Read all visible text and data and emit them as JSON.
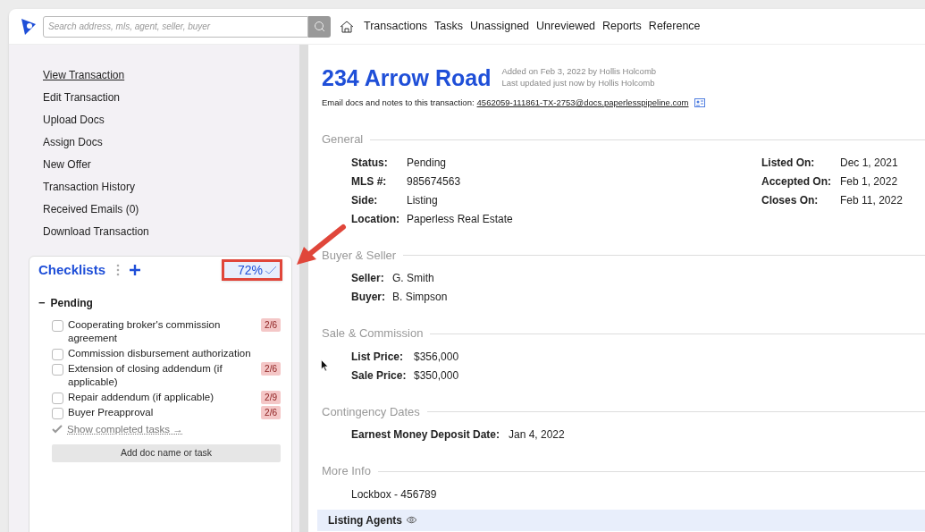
{
  "header": {
    "search": {
      "placeholder": "Search address, mls, agent, seller, buyer"
    },
    "nav": [
      {
        "label": "Transactions",
        "selected": false
      },
      {
        "label": "Tasks",
        "selected": false
      },
      {
        "label": "Unassigned",
        "selected": false
      },
      {
        "label": "Unreviewed",
        "selected": false
      },
      {
        "label": "Reports",
        "selected": false
      },
      {
        "label": "Reference",
        "selected": false
      }
    ]
  },
  "sidebar": {
    "items": [
      {
        "label": "View Transaction",
        "selected": true
      },
      {
        "label": "Edit Transaction",
        "selected": false
      },
      {
        "label": "Upload Docs",
        "selected": false
      },
      {
        "label": "Assign Docs",
        "selected": false
      },
      {
        "label": "New Offer",
        "selected": false
      },
      {
        "label": "Transaction History",
        "selected": false
      },
      {
        "label": "Received Emails (0)",
        "selected": false
      },
      {
        "label": "Download Transaction",
        "selected": false
      }
    ]
  },
  "checklists": {
    "title": "Checklists",
    "percent": "72%",
    "group": {
      "toggle": "−",
      "label": "Pending",
      "expanded": true
    },
    "tasks": [
      {
        "label": "Cooperating broker's commission agreement",
        "checked": false,
        "count": "2/6"
      },
      {
        "label": "Commission disbursement authorization",
        "checked": false
      },
      {
        "label": "Extension of closing addendum (if applicable)",
        "checked": false,
        "count": "2/6"
      },
      {
        "label": "Repair addendum (if applicable)",
        "checked": false,
        "count": "2/9"
      },
      {
        "label": "Buyer Preapproval",
        "checked": false,
        "count": "2/6"
      }
    ],
    "show_completed": "Show completed tasks →",
    "add_button": "Add doc name or task"
  },
  "transaction": {
    "title": "234 Arrow Road",
    "added": "Added on Feb 3, 2022 by Hollis Holcomb",
    "updated": "Last updated just now by Hollis Holcomb",
    "email_label": "Email docs and notes to this transaction:",
    "email": "4562059-111861-TX-2753@docs.paperlesspipeline.com",
    "sections": [
      {
        "title": "General",
        "left": [
          {
            "label": "Status:",
            "value": "Pending"
          },
          {
            "label": "MLS #:",
            "value": "985674563"
          },
          {
            "label": "Side:",
            "value": "Listing"
          },
          {
            "label": "Location:",
            "value": "Paperless Real Estate"
          }
        ],
        "right": [
          {
            "label": "Listed On:",
            "value": "Dec 1, 2021"
          },
          {
            "label": "Accepted On:",
            "value": "Feb 1, 2022"
          },
          {
            "label": "Closes On:",
            "value": "Feb 11, 2022"
          }
        ]
      },
      {
        "title": "Buyer & Seller",
        "left": [
          {
            "label": "Seller:",
            "value": "G. Smith"
          },
          {
            "label": "Buyer:",
            "value": "B. Simpson"
          }
        ]
      },
      {
        "title": "Sale & Commission",
        "left": [
          {
            "label": "List Price:",
            "value": "$356,000"
          },
          {
            "label": "Sale Price:",
            "value": "$350,000"
          }
        ]
      },
      {
        "title": "Contingency Dates",
        "left": [
          {
            "label": "Earnest Money Deposit Date:",
            "value": "Jan 4, 2022"
          }
        ]
      },
      {
        "title": "More Info",
        "notes": [
          "Lockbox - 456789"
        ]
      }
    ],
    "agents_header": "Listing Agents"
  }
}
